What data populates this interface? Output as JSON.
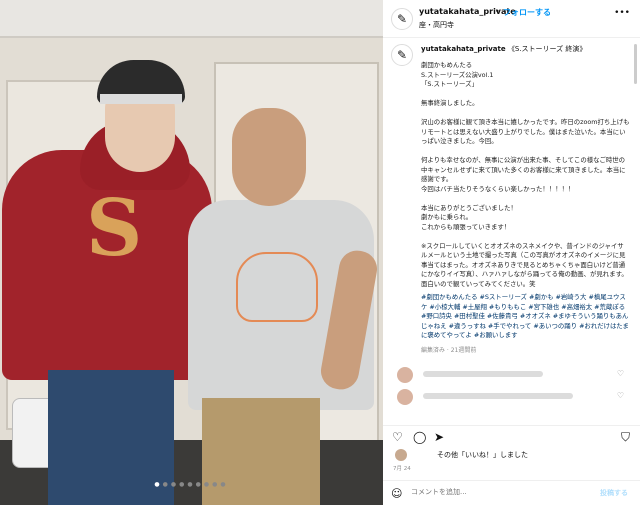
{
  "post": {
    "username": "yutatakahata_private",
    "separator": "•",
    "follow_label": "フォローする",
    "location": "座・高円寺",
    "more_icon": "more-icon"
  },
  "caption": {
    "username": "yutatakahata_private",
    "title": "《S.ストーリーズ 終演》",
    "body": "劇団かもめんたる\nS.ストーリーズ公演vol.1\n「S.ストーリーズ」\n\n無事終演しました。\n\n沢山のお客様に観て頂き本当に嬉しかったです。昨日のzoom打ち上げもリモートとは思えない大盛り上がりでした。僕はまた泣いた。本当にいっぱい泣きました。今回。\n\n何よりも幸せなのが、無事に公演が出来た事、そしてこの様なご時世の中キャンセルせずに来て頂いた多くのお客様に来て頂きました。本当に感謝です。\n今回はバチ当たりそうなくらい楽しかった！！！！！\n\n本当にありがとうございました！\n劇かもに乗られ。\nこれからも頑張っていきます！\n\n※スクロールしていくとオオズネのスネメイクや、普インドのジャイサルメールという土地で撮った写真（この写真がオオズネのイメージに見事当てはまった。オオズネありきで見るとめちゃくちゃ面白いけど普通にかなりイイ写真）、ハァハァしながら踊ってる俺の動画、が見れます。面白いので観ていってみてください。笑",
    "tags": "#劇団かもめんたる #Sストーリーズ #劇かも #岩崎う大 #槙尾ユウスケ #小椋大輔 #土屋翔 #もりももこ #宮下雄也 #高畑裕太 #荒蔵ぽる #野口詩央 #田村聖佳 #佐藤貴弓 #オオズネ #まゆそういう踊りもあんじゃねえ #違うっすね #手でやれって #あいつの踊り #おれだけはたまに褒めてやってよ #お願いします",
    "meta": "編集済み · 21週間前"
  },
  "actions": {
    "like_icon": "heart-icon",
    "comment_icon": "comment-icon",
    "share_icon": "share-icon",
    "save_icon": "bookmark-icon"
  },
  "likes": {
    "text": "その他「いいね！」しました"
  },
  "date": "7月 24",
  "comment_bar": {
    "placeholder": "コメントを追加...",
    "post_label": "投稿する"
  }
}
